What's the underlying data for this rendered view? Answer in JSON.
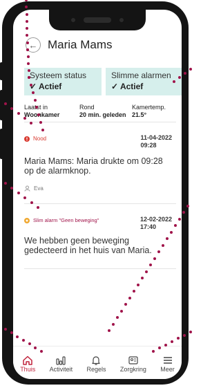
{
  "header": {
    "title": "Maria Mams",
    "back_icon": "arrow-left-icon"
  },
  "status": [
    {
      "label": "Systeem status",
      "value": "✓ Actief"
    },
    {
      "label": "Slimme alarmen",
      "value": "✓ Actief"
    }
  ],
  "info": [
    {
      "label": "Laatst in",
      "value": "Woonkamer"
    },
    {
      "label": "Rond",
      "value": "20 min. geleden"
    },
    {
      "label": "Kamertemp.",
      "value": "21.5°"
    }
  ],
  "events": [
    {
      "tag": "Nood",
      "tag_color": "#d93a30",
      "date": "11-04-2022",
      "time": "09:28",
      "message": "Maria Mams: Maria drukte om 09:28 op de alarmknop.",
      "user": "Eva"
    },
    {
      "tag": "Slim alarm \"Geen beweging\"",
      "tag_color": "#f0a830",
      "date": "12-02-2022",
      "time": "17:40",
      "message": "We hebben geen beweging gedecteerd in het huis van Maria."
    }
  ],
  "nav": [
    {
      "label": "Thuis",
      "icon": "home-icon",
      "active": true
    },
    {
      "label": "Activiteit",
      "icon": "activity-icon"
    },
    {
      "label": "Regels",
      "icon": "bell-icon"
    },
    {
      "label": "Zorgkring",
      "icon": "contact-card-icon"
    },
    {
      "label": "Meer",
      "icon": "menu-icon"
    }
  ],
  "colors": {
    "accent": "#c0223b",
    "status_bg": "#d6efec",
    "annotation_dots": "#a0144a"
  }
}
